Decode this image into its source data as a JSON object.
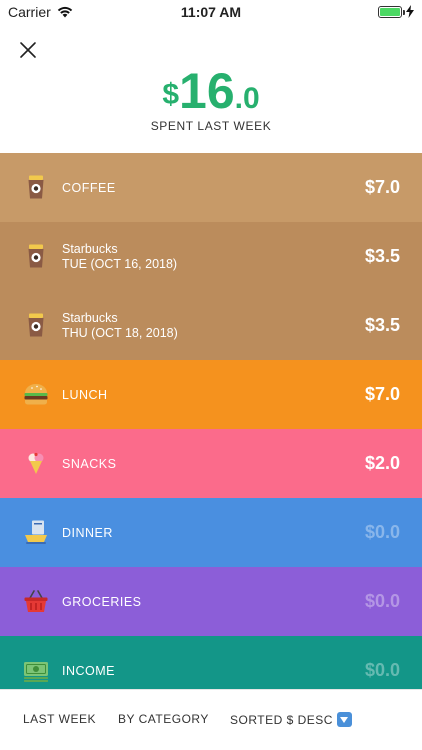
{
  "status_bar": {
    "carrier": "Carrier",
    "time": "11:07 AM"
  },
  "header": {
    "total_currency": "$",
    "total_int": "16",
    "total_dec": ".0",
    "subtitle": "SPENT LAST WEEK",
    "accent_color": "#27b06e"
  },
  "rows": {
    "coffee": {
      "label": "COFFEE",
      "amount": "$7.0",
      "icon": "coffee-cup-icon",
      "color": "#c79a68"
    },
    "starbucks_1": {
      "merchant": "Starbucks",
      "date": "TUE (OCT 16, 2018)",
      "amount": "$3.5",
      "icon": "coffee-cup-icon"
    },
    "starbucks_2": {
      "merchant": "Starbucks",
      "date": "THU (OCT 18, 2018)",
      "amount": "$3.5",
      "icon": "coffee-cup-icon"
    },
    "lunch": {
      "label": "LUNCH",
      "amount": "$7.0",
      "icon": "burger-icon",
      "color": "#f5921e"
    },
    "snacks": {
      "label": "SNACKS",
      "amount": "$2.0",
      "icon": "ice-cream-icon",
      "color": "#fb6b8b"
    },
    "dinner": {
      "label": "DINNER",
      "amount": "$0.0",
      "icon": "dinner-plate-icon",
      "color": "#4a8fe0"
    },
    "groceries": {
      "label": "GROCERIES",
      "amount": "$0.0",
      "icon": "basket-icon",
      "color": "#8c5ed8"
    },
    "income": {
      "label": "INCOME",
      "amount": "$0.0",
      "icon": "money-icon",
      "color": "#139688"
    }
  },
  "bottom_bar": {
    "period": "LAST WEEK",
    "grouping": "BY CATEGORY",
    "sort": "SORTED $ DESC"
  }
}
